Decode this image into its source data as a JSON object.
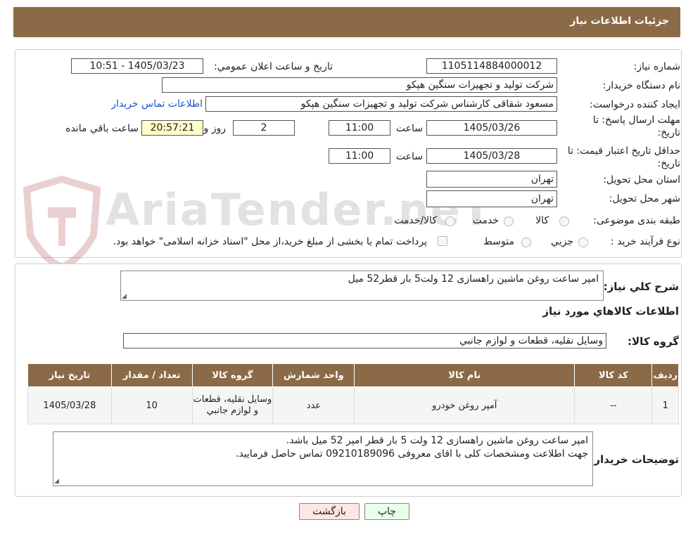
{
  "header": {
    "title": "جزئیات اطلاعات نیاز"
  },
  "form": {
    "need_number_label": "شماره نیاز:",
    "need_number": "1105114884000012",
    "announce_label": "تاریخ و ساعت اعلان عمومي:",
    "announce_value": "1405/03/23 - 10:51",
    "buyer_org_label": "نام دستگاه خريدار:",
    "buyer_org": "شرکت تولید و تجهیزات سنگین هپکو",
    "requester_label": "ايجاد کننده درخواست:",
    "requester": "مسعود شقاقی کارشناس شرکت تولید و تجهیزات سنگین هپکو",
    "contact_link": "اطلاعات تماس خريدار",
    "deadline_label_1": "مهلت ارسال پاسخ: تا",
    "deadline_label_2": "تاريخ:",
    "deadline_date": "1405/03/26",
    "time_label": "ساعت",
    "deadline_time": "11:00",
    "days_value": "2",
    "days_label": "روز و",
    "remaining_time": "20:57:21",
    "remaining_label": "ساعت باقي مانده",
    "validity_label_1": "حداقل تاريخ اعتبار قيمت: تا",
    "validity_label_2": "تاريخ:",
    "validity_date": "1405/03/28",
    "validity_time": "11:00",
    "province_label": "استان محل تحويل:",
    "province": "تهران",
    "city_label": "شهر محل تحويل:",
    "city": "تهران",
    "category_label": "طبقه بندی موضوعی:",
    "category_options": [
      "کالا",
      "خدمت",
      "کالا/خدمت"
    ],
    "process_label": "نوع فرآيند خريد :",
    "process_options": [
      "جزيي",
      "متوسط"
    ],
    "payment_note": "پرداخت تمام يا بخشی از مبلغ خريد،از محل \"اسناد خزانه اسلامی\" خواهد بود."
  },
  "watermark": {
    "text": "AriaTender.neT"
  },
  "details": {
    "summary_label": "شرح کلي نياز:",
    "summary": "امپر ساعت روغن ماشین راهسازی 12 ولت5 بار قطر52 میل",
    "goods_info_title": "اطلاعات کالاهاي مورد نياز",
    "group_label": "گروه کالا:",
    "group": "وسايل نقليه، قطعات و لوازم جانبي"
  },
  "table": {
    "headers": [
      "رديف",
      "کد کالا",
      "نام کالا",
      "واحد شمارش",
      "گروه کالا",
      "تعداد / مقدار",
      "تاريخ نياز"
    ],
    "rows": [
      [
        "1",
        "--",
        "آمپر روغن خودرو",
        "عدد",
        "وسايل نقليه، قطعات و لوازم جانبي",
        "10",
        "1405/03/28"
      ]
    ]
  },
  "notes": {
    "label": "توضيحات خريدار:",
    "line1": "امپر ساعت روغن ماشین راهسازی 12 ولت 5 بار قطر امپر 52 میل باشد.",
    "line2": "جهت اطلاعت ومشخصات کلی با اقای معروفی 09210189096 تماس حاصل فرمایید."
  },
  "buttons": {
    "print": "چاپ",
    "back": "بازگشت"
  },
  "colors": {
    "header_bg": "#8b6b47",
    "remaining_bg": "#ffffcc",
    "back_button_bg": "#ffe6e6",
    "print_button_bg": "#eaffea",
    "link": "#1a56c8"
  }
}
